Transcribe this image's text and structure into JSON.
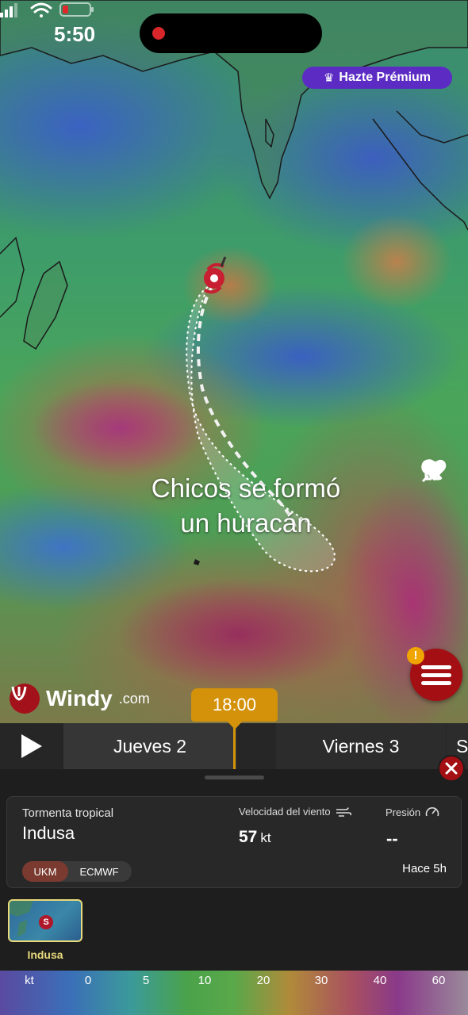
{
  "status_bar": {
    "time": "5:50"
  },
  "premium": {
    "crown_icon": "crown-icon",
    "label": "Hazte Prémium"
  },
  "overlay_caption": {
    "line1": "Chicos se formó",
    "line2": "un huracán"
  },
  "map_tools": [
    "home-icon",
    "search-icon",
    "pin-icon",
    "heart-icon"
  ],
  "brand": {
    "name": "Windy",
    "suffix": ".com"
  },
  "timeline": {
    "current_time": "18:00",
    "days": [
      "Jueves 2",
      "Viernes 3",
      "S"
    ]
  },
  "storm": {
    "type": "Tormenta tropical",
    "name": "Indusa",
    "wind_label": "Velocidad del viento",
    "wind_value": "57",
    "wind_unit": "kt",
    "pressure_label": "Presión",
    "pressure_value": "--",
    "updated": "Hace 5h",
    "models": [
      "UKM",
      "ECMWF"
    ],
    "selected_model": "UKM"
  },
  "storm_list": [
    {
      "badge": "S",
      "name": "Indusa"
    }
  ],
  "scale": {
    "unit": "kt",
    "ticks": [
      "0",
      "5",
      "10",
      "20",
      "30",
      "40",
      "60"
    ]
  },
  "colors": {
    "accent": "#d4920b",
    "brand": "#a30f12",
    "premium": "#5b2bc4"
  }
}
